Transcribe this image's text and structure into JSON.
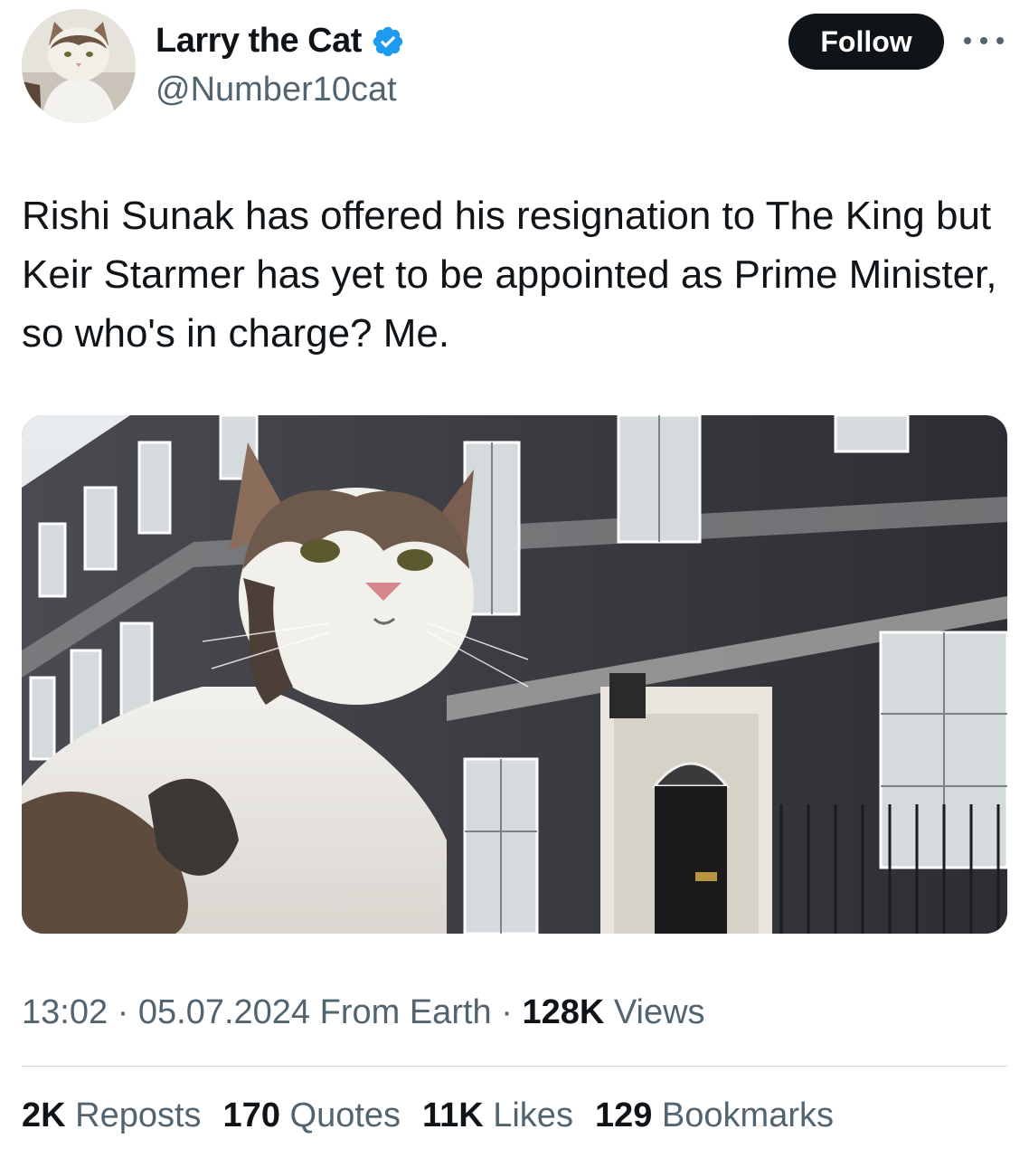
{
  "author": {
    "display_name": "Larry the Cat",
    "handle": "@Number10cat",
    "verified": true,
    "verified_color": "#1d9bf0",
    "avatar_icon": "cat-avatar"
  },
  "actions": {
    "follow_label": "Follow",
    "more_icon": "more-horizontal-icon"
  },
  "tweet": {
    "text": "Rishi Sunak has offered his resignation to The King but Keir Starmer has yet to be appointed as Prime Minister, so who's in charge? Me.",
    "media_description_icon": "photo-cat-downing-street"
  },
  "meta": {
    "time": "13:02",
    "separator": "·",
    "date": "05.07.2024",
    "source": "From Earth",
    "views_count": "128K",
    "views_label": "Views"
  },
  "stats": [
    {
      "count": "2K",
      "label": "Reposts"
    },
    {
      "count": "170",
      "label": "Quotes"
    },
    {
      "count": "11K",
      "label": "Likes"
    },
    {
      "count": "129",
      "label": "Bookmarks"
    }
  ],
  "colors": {
    "text_primary": "#0f1419",
    "text_secondary": "#536471",
    "button_bg": "#0f1419",
    "divider": "#cfd9de"
  }
}
